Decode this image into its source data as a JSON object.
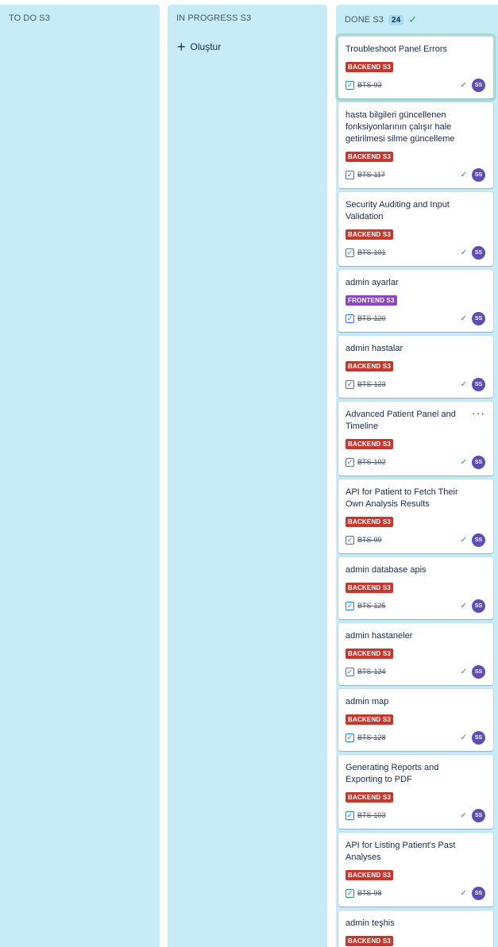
{
  "columns": {
    "todo": {
      "title": "TO DO S3"
    },
    "inprogress": {
      "title": "IN PROGRESS S3",
      "create_label": "Oluştur"
    },
    "done": {
      "title": "DONE S3",
      "count": "24"
    }
  },
  "colors": {
    "backend": "#c9372c",
    "frontend": "#8f46c1",
    "avatar": "#5e4db2",
    "column": "#c6ecf8"
  },
  "cards": [
    {
      "title": "Troubleshoot Panel Errors",
      "label": "BACKEND S3",
      "label_type": "backend",
      "key": "BTS-93",
      "avatar": "SS"
    },
    {
      "title": "hasta bilgileri güncellenen fonksiyonlarının çalışır hale getirilmesi silme güncelleme",
      "label": "BACKEND S3",
      "label_type": "backend",
      "key": "BTS-117",
      "avatar": "SS"
    },
    {
      "title": "Security Auditing and Input Validation",
      "label": "BACKEND S3",
      "label_type": "backend",
      "key": "BTS-101",
      "avatar": "SS"
    },
    {
      "title": "admin ayarlar",
      "label": "FRONTEND S3",
      "label_type": "frontend",
      "key": "BTS-120",
      "avatar": "SS"
    },
    {
      "title": "admin hastalar",
      "label": "BACKEND S3",
      "label_type": "backend",
      "key": "BTS-123",
      "avatar": "SS"
    },
    {
      "title": "Advanced Patient Panel and Timeline",
      "label": "BACKEND S3",
      "label_type": "backend",
      "key": "BTS-102",
      "avatar": "SS"
    },
    {
      "title": "API for Patient to Fetch Their Own Analysis Results",
      "label": "BACKEND S3",
      "label_type": "backend",
      "key": "BTS-99",
      "avatar": "SS"
    },
    {
      "title": "admin database apis",
      "label": "BACKEND S3",
      "label_type": "backend",
      "key": "BTS-125",
      "avatar": "SS"
    },
    {
      "title": "admin hastaneler",
      "label": "BACKEND S3",
      "label_type": "backend",
      "key": "BTS-124",
      "avatar": "SS"
    },
    {
      "title": "admin map",
      "label": "BACKEND S3",
      "label_type": "backend",
      "key": "BTS-128",
      "avatar": "SS"
    },
    {
      "title": "Generating Reports and Exporting to PDF",
      "label": "BACKEND S3",
      "label_type": "backend",
      "key": "BTS-103",
      "avatar": "SS"
    },
    {
      "title": "API for Listing Patient's Past Analyses",
      "label": "BACKEND S3",
      "label_type": "backend",
      "key": "BTS-98",
      "avatar": "SS"
    },
    {
      "title": "admin teşhis",
      "label": "BACKEND S3",
      "label_type": "backend",
      "key": "",
      "avatar": ""
    }
  ],
  "icons": {
    "create": "plus-icon",
    "column_done": "check-icon",
    "card_checkbox": "checkbox-icon",
    "card_status": "check-icon",
    "card_menu": "more-icon"
  }
}
